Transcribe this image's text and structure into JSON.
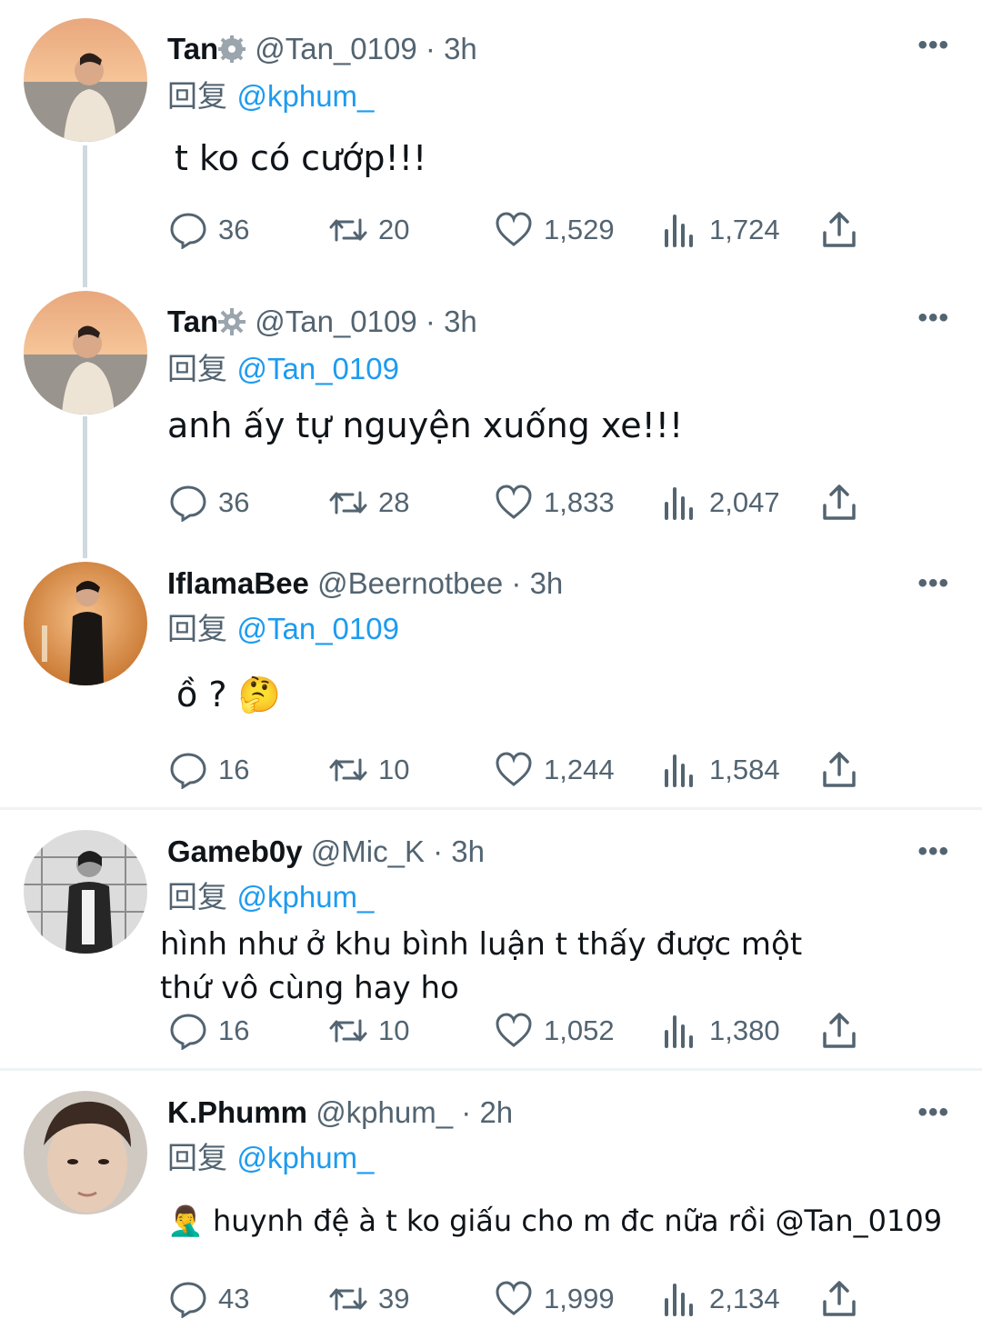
{
  "reply_prefix": "回复",
  "more_glyph": "•••",
  "tweets": [
    {
      "name": "Tan",
      "badge": "gear-badge-icon",
      "handle": "@Tan_0109",
      "sep": "·",
      "time": "3h",
      "reply_to": "@kphum_",
      "text": "t ko có cướp!!!",
      "replies": "36",
      "retweets": "20",
      "likes": "1,529",
      "views": "1,724",
      "avatar_colors": [
        "#f3b07a",
        "#c9d6e3"
      ]
    },
    {
      "name": "Tan",
      "badge": "gear-badge-icon",
      "handle": "@Tan_0109",
      "sep": "·",
      "time": "3h",
      "reply_to": "@Tan_0109",
      "text": "anh ấy tự nguyện xuống xe!!!",
      "replies": "36",
      "retweets": "28",
      "likes": "1,833",
      "views": "2,047",
      "avatar_colors": [
        "#f3b07a",
        "#c9d6e3"
      ]
    },
    {
      "name": "IflamaBee",
      "handle": "@Beernotbee",
      "sep": "·",
      "time": "3h",
      "reply_to": "@Tan_0109",
      "text": "ồ ?",
      "emoji": "🤔",
      "replies": "16",
      "retweets": "10",
      "likes": "1,244",
      "views": "1,584",
      "avatar_colors": [
        "#e59b4f",
        "#1e1a18"
      ]
    },
    {
      "name": "Gameb0y",
      "handle": "@Mic_K",
      "sep": "·",
      "time": "3h",
      "reply_to": "@kphum_",
      "text_line1": "hình như ở khu bình luận t thấy được một",
      "text_line2": "thứ vô cùng hay ho",
      "replies": "16",
      "retweets": "10",
      "likes": "1,052",
      "views": "1,380",
      "avatar_colors": [
        "#d9d9d9",
        "#2b2b2b"
      ]
    },
    {
      "name": "K.Phumm",
      "handle": "@kphum_",
      "sep": "·",
      "time": "2h",
      "reply_to": "@kphum_",
      "emoji": "🤦‍♂️",
      "text": "huynh đệ à t ko giấu cho m đc nữa rồi",
      "text_mention": "@Tan_0109",
      "replies": "43",
      "retweets": "39",
      "likes": "1,999",
      "views": "2,134",
      "avatar_colors": [
        "#d8c2b0",
        "#3a2a22"
      ]
    }
  ],
  "colors": {
    "link": "#1d9bf0",
    "muted": "#536471",
    "text": "#0f1419",
    "thread_line": "#cfd9de"
  }
}
